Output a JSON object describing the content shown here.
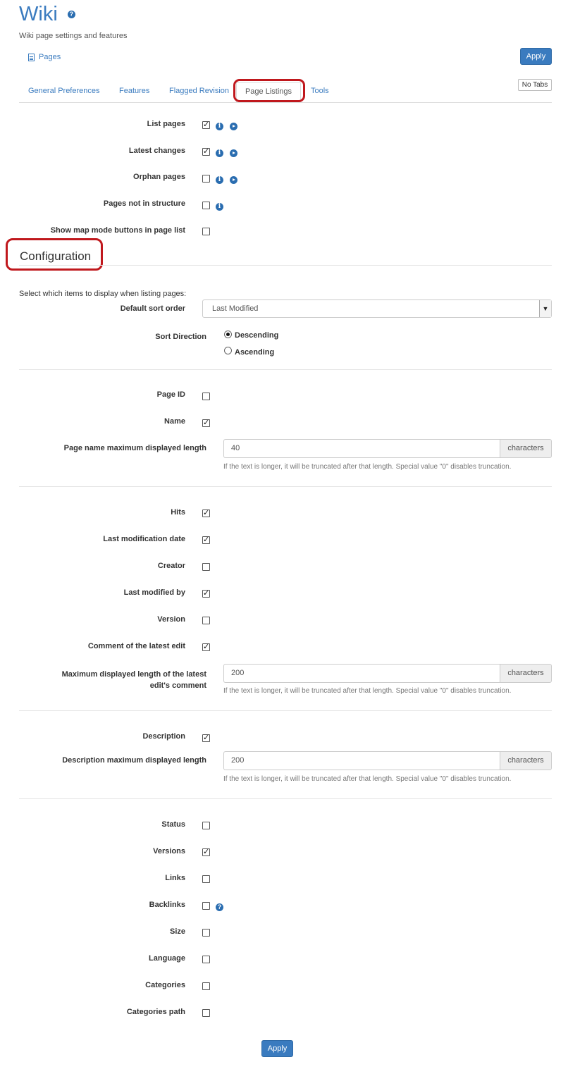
{
  "header": {
    "title": "Wiki",
    "help_icon": "question-circle-icon",
    "subtitle": "Wiki page settings and features",
    "pages_link": "Pages",
    "apply_label": "Apply",
    "no_tabs_label": "No Tabs"
  },
  "tabs": [
    {
      "label": "General Preferences",
      "active": false
    },
    {
      "label": "Features",
      "active": false
    },
    {
      "label": "Flagged Revision",
      "active": false
    },
    {
      "label": "Page Listings",
      "active": true
    },
    {
      "label": "Tools",
      "active": false
    }
  ],
  "listing_options": [
    {
      "label": "List pages",
      "checked": true,
      "icons": [
        "info-icon",
        "play-icon"
      ]
    },
    {
      "label": "Latest changes",
      "checked": true,
      "icons": [
        "info-icon",
        "play-icon"
      ]
    },
    {
      "label": "Orphan pages",
      "checked": false,
      "icons": [
        "info-icon",
        "play-icon"
      ]
    },
    {
      "label": "Pages not in structure",
      "checked": false,
      "icons": [
        "info-icon"
      ]
    },
    {
      "label": "Show map mode buttons in page list",
      "checked": false,
      "icons": []
    }
  ],
  "configuration": {
    "heading": "Configuration",
    "intro": "Select which items to display when listing pages:",
    "sort_order_label": "Default sort order",
    "sort_order_value": "Last Modified",
    "sort_direction_label": "Sort Direction",
    "sort_direction_options": [
      {
        "label": "Descending",
        "selected": true
      },
      {
        "label": "Ascending",
        "selected": false
      }
    ]
  },
  "group1": {
    "page_id": {
      "label": "Page ID",
      "checked": false
    },
    "name": {
      "label": "Name",
      "checked": true
    },
    "name_length": {
      "label": "Page name maximum displayed length",
      "value": "40",
      "addon": "characters",
      "help": "If the text is longer, it will be truncated after that length. Special value \"0\" disables truncation."
    }
  },
  "group2": {
    "hits": {
      "label": "Hits",
      "checked": true
    },
    "last_mod_date": {
      "label": "Last modification date",
      "checked": true
    },
    "creator": {
      "label": "Creator",
      "checked": false
    },
    "last_mod_by": {
      "label": "Last modified by",
      "checked": true
    },
    "version": {
      "label": "Version",
      "checked": false
    },
    "comment": {
      "label": "Comment of the latest edit",
      "checked": true
    },
    "comment_length": {
      "label_line1": "Maximum displayed length of the latest",
      "label_line2": "edit's comment",
      "value": "200",
      "addon": "characters",
      "help": "If the text is longer, it will be truncated after that length. Special value \"0\" disables truncation."
    }
  },
  "group3": {
    "description": {
      "label": "Description",
      "checked": true
    },
    "description_length": {
      "label": "Description maximum displayed length",
      "value": "200",
      "addon": "characters",
      "help": "If the text is longer, it will be truncated after that length. Special value \"0\" disables truncation."
    }
  },
  "group4": [
    {
      "label": "Status",
      "checked": false
    },
    {
      "label": "Versions",
      "checked": true
    },
    {
      "label": "Links",
      "checked": false
    },
    {
      "label": "Backlinks",
      "checked": false,
      "icon": "question-circle-icon"
    },
    {
      "label": "Size",
      "checked": false
    },
    {
      "label": "Language",
      "checked": false
    },
    {
      "label": "Categories",
      "checked": false
    },
    {
      "label": "Categories path",
      "checked": false
    }
  ]
}
